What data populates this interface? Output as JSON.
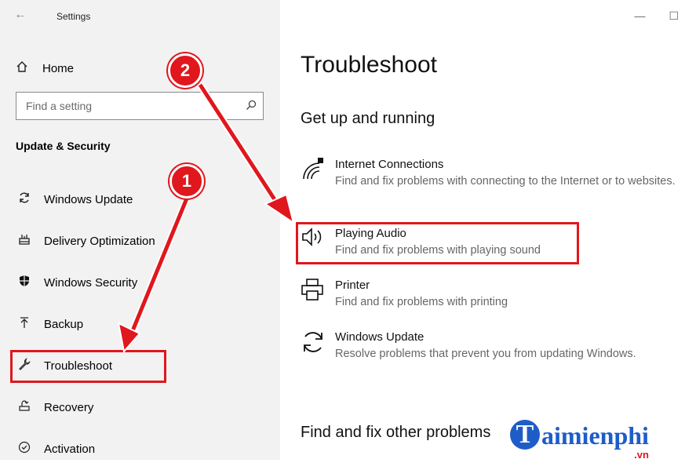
{
  "window": {
    "title": "Settings",
    "minimize_symbol": "—",
    "maximize_symbol": "☐"
  },
  "sidebar": {
    "home_label": "Home",
    "search_placeholder": "Find a setting",
    "section_title": "Update & Security",
    "items": [
      {
        "label": "Windows Update",
        "icon": "refresh-icon"
      },
      {
        "label": "Delivery Optimization",
        "icon": "delivery-optimization-icon"
      },
      {
        "label": "Windows Security",
        "icon": "shield-icon"
      },
      {
        "label": "Backup",
        "icon": "backup-icon"
      },
      {
        "label": "Troubleshoot",
        "icon": "wrench-icon"
      },
      {
        "label": "Recovery",
        "icon": "recovery-icon"
      },
      {
        "label": "Activation",
        "icon": "activation-icon"
      }
    ]
  },
  "main": {
    "title": "Troubleshoot",
    "section_get_up": "Get up and running",
    "troubleshooters": [
      {
        "name": "Internet Connections",
        "desc": "Find and fix problems with connecting to the Internet or to websites.",
        "icon": "network-icon"
      },
      {
        "name": "Playing Audio",
        "desc": "Find and fix problems with playing sound",
        "icon": "speaker-icon"
      },
      {
        "name": "Printer",
        "desc": "Find and fix problems with printing",
        "icon": "printer-icon"
      },
      {
        "name": "Windows Update",
        "desc": "Resolve problems that prevent you from updating Windows.",
        "icon": "refresh-icon"
      }
    ],
    "section_other": "Find and fix other problems"
  },
  "annotations": {
    "badge_1": "1",
    "badge_2": "2",
    "accent_color": "#e0171d"
  },
  "watermark": {
    "letter": "T",
    "text": "aimienphi",
    "suffix": ".vn"
  }
}
